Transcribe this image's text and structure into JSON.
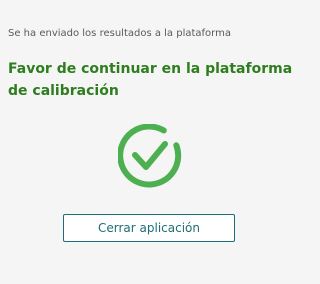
{
  "status": {
    "message": "Se ha enviado los resultados a la plataforma"
  },
  "headline": {
    "text": "Favor de continuar en la plataforma de calibración"
  },
  "icon": {
    "name": "check-circle-icon",
    "color": "#4caf50"
  },
  "actions": {
    "close_label": "Cerrar aplicación"
  },
  "colors": {
    "headline": "#2e7d1e",
    "button_border": "#1e6e78",
    "background": "#f5f5f5"
  }
}
